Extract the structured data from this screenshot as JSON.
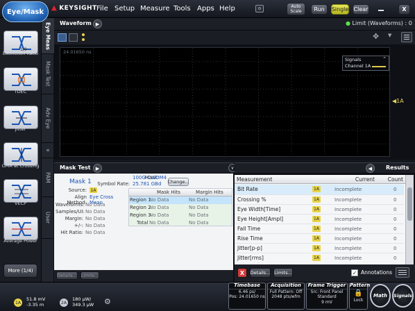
{
  "app": {
    "mode_button": "Eye/Mask",
    "brand": "KEYSIGHT",
    "menu": [
      "File",
      "Setup",
      "Measure",
      "Tools",
      "Apps",
      "Help"
    ],
    "buttons": {
      "autoscale": "Auto Scale",
      "run": "Run",
      "single": "Single",
      "clear": "Clear",
      "close": "X"
    }
  },
  "sidebar": {
    "items": [
      {
        "label": "Extinction Ratio",
        "icon": "extinction-ratio-icon"
      },
      {
        "label": "TDEC",
        "icon": "tdec-icon"
      },
      {
        "label": "Jitter",
        "icon": "jitter-icon"
      },
      {
        "label": "OMA at Crossing",
        "icon": "oma-crossing-icon"
      },
      {
        "label": "VECP",
        "icon": "vecp-icon"
      },
      {
        "label": "Average Power",
        "icon": "average-power-icon"
      }
    ],
    "more_button": "More (1/4)"
  },
  "vertical_tabs": [
    "Eye Meas",
    "Mask Test",
    "Adv Eye",
    "PAM",
    "User"
  ],
  "waveform": {
    "title": "Waveform",
    "limit_status": "Limit (Waveforms) : 0",
    "time_readout": "24.01650 ns",
    "signals_title": "Signals",
    "signals_channel": "Channel 1A",
    "channel_marker": "1A",
    "color": "#e0c84a"
  },
  "mask_test": {
    "header": "Mask Test",
    "source_badge": "1A",
    "mask_label": "Mask:",
    "mask_value": "100G-CWDM4",
    "symbol_rate_label": "Symbol Rate:",
    "symbol_rate_value": "25.781 GBd",
    "change_button": "Change...",
    "mask_name": "Mask 1",
    "rows": [
      {
        "key": "Source:",
        "value": ""
      },
      {
        "key": "Align Method:",
        "value": "Eye Cross Mean"
      },
      {
        "key": "Waveforms:",
        "value": "No Data"
      },
      {
        "key": "Samples/UI:",
        "value": "No Data"
      },
      {
        "key": "Margin:",
        "value": "No Data"
      },
      {
        "key": "+/-:",
        "value": "No Data"
      },
      {
        "key": "Hit Ratio:",
        "value": "No Data"
      }
    ],
    "table": {
      "headers": [
        "",
        "Mask Hits",
        "Margin Hits"
      ],
      "rows": [
        [
          "Region 1",
          "No Data",
          "No Data"
        ],
        [
          "Region 2",
          "No Data",
          "No Data"
        ],
        [
          "Region 3",
          "No Data",
          "No Data"
        ],
        [
          "Total",
          "No Data",
          "No Data"
        ]
      ]
    },
    "footer_buttons": [
      "Details...",
      "Limits..."
    ]
  },
  "results": {
    "header": "Results",
    "columns": [
      "Measurement",
      "Current",
      "Count"
    ],
    "rows": [
      {
        "name": "Bit Rate",
        "source": "1A",
        "current": "Incomplete",
        "count": "0"
      },
      {
        "name": "Crossing %",
        "source": "1A",
        "current": "Incomplete",
        "count": "0"
      },
      {
        "name": "Eye Width[Time]",
        "source": "1A",
        "current": "Incomplete",
        "count": "0"
      },
      {
        "name": "Eye Height[Ampl]",
        "source": "1A",
        "current": "Incomplete",
        "count": "0"
      },
      {
        "name": "Fall Time",
        "source": "1A",
        "current": "Incomplete",
        "count": "0"
      },
      {
        "name": "Rise Time",
        "source": "1A",
        "current": "Incomplete",
        "count": "0"
      },
      {
        "name": "Jitter[p-p]",
        "source": "1A",
        "current": "Incomplete",
        "count": "0"
      },
      {
        "name": "Jitter[rms]",
        "source": "1A",
        "current": "Incomplete",
        "count": "0"
      }
    ],
    "footer": {
      "delete": "X",
      "details": "Details...",
      "limits": "Limits...",
      "annotations": "Annotations",
      "annotations_checked": true
    }
  },
  "bottom": {
    "ch1": {
      "badge": "1A",
      "v1": "51.8 mV",
      "v2": "-3.35 m"
    },
    "ch2": {
      "badge": "2A",
      "v1": "180 µW/",
      "v2": "349.3 µW"
    },
    "timebase": {
      "title": "Timebase",
      "l1": "6.46 ps/",
      "l2": "Pos: 24.01650 ns"
    },
    "acquisition": {
      "title": "Acquisition",
      "l1": "Full Pattern: Off",
      "l2": "2048 pts/wfm"
    },
    "frame_trigger": {
      "title": "Frame Trigger",
      "l1": "Src: Front Panel",
      "l2": "Standard",
      "l3": "9 mV"
    },
    "pattern": {
      "title": "Pattern",
      "l1": "Lock"
    },
    "math": "Math",
    "signals": "Signals"
  }
}
